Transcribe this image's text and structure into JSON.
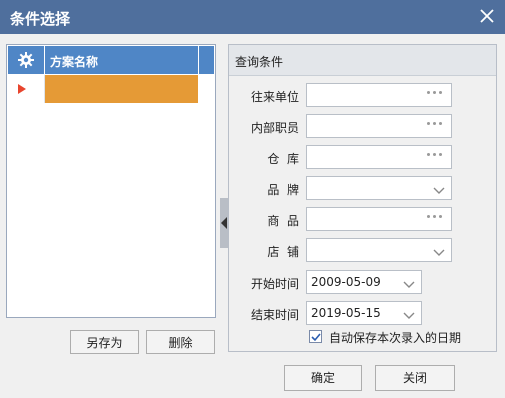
{
  "window": {
    "title": "条件选择"
  },
  "scheme_list": {
    "column_name": "方案名称",
    "rows": [
      {
        "name": ""
      }
    ]
  },
  "left_buttons": {
    "save_as": "另存为",
    "delete": "删除"
  },
  "query": {
    "header": "查询条件",
    "fields": {
      "partner": {
        "label": "往来单位",
        "value": ""
      },
      "staff": {
        "label": "内部职员",
        "value": ""
      },
      "warehouse": {
        "label": "仓  库",
        "value": ""
      },
      "brand": {
        "label": "品  牌",
        "value": ""
      },
      "product": {
        "label": "商  品",
        "value": ""
      },
      "store": {
        "label": "店  铺",
        "value": ""
      },
      "start_time": {
        "label": "开始时间",
        "value": "2009-05-09"
      },
      "end_time": {
        "label": "结束时间",
        "value": "2019-05-15"
      }
    },
    "autosave": {
      "label": "自动保存本次录入的日期",
      "checked": true
    }
  },
  "footer_buttons": {
    "ok": "确定",
    "close": "关闭"
  },
  "colors": {
    "titlebar": "#4f6f9d",
    "list_header": "#4f86c6",
    "selected_row": "#e59a36",
    "row_indicator": "#e8452e"
  },
  "icons": {
    "close": "close-icon",
    "settings": "gear-icon",
    "lookup": "ellipsis-icon",
    "dropdown": "chevron-down-icon",
    "splitter": "collapse-left-icon"
  }
}
